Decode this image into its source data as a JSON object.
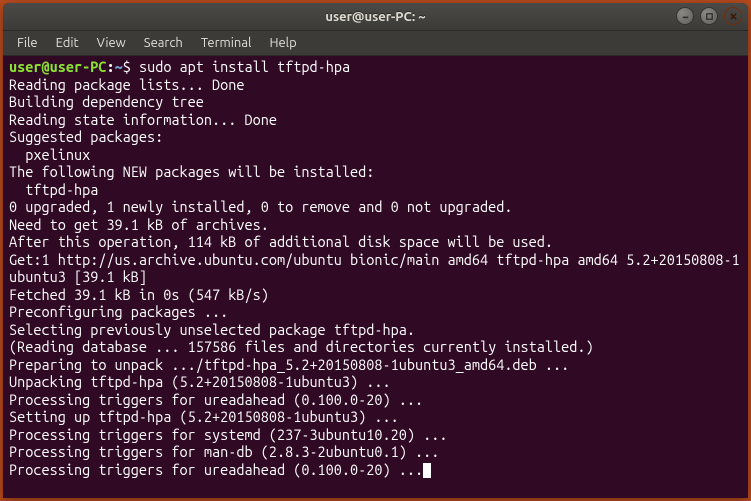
{
  "title": "user@user-PC: ~",
  "menus": [
    "File",
    "Edit",
    "View",
    "Search",
    "Terminal",
    "Help"
  ],
  "prompt": {
    "userhost": "user@user-PC",
    "path": "~",
    "symbol": "$"
  },
  "command": "sudo apt install tftpd-hpa",
  "output": "Reading package lists... Done\nBuilding dependency tree\nReading state information... Done\nSuggested packages:\n  pxelinux\nThe following NEW packages will be installed:\n  tftpd-hpa\n0 upgraded, 1 newly installed, 0 to remove and 0 not upgraded.\nNeed to get 39.1 kB of archives.\nAfter this operation, 114 kB of additional disk space will be used.\nGet:1 http://us.archive.ubuntu.com/ubuntu bionic/main amd64 tftpd-hpa amd64 5.2+20150808-1ubuntu3 [39.1 kB]\nFetched 39.1 kB in 0s (547 kB/s)\nPreconfiguring packages ...\nSelecting previously unselected package tftpd-hpa.\n(Reading database ... 157586 files and directories currently installed.)\nPreparing to unpack .../tftpd-hpa_5.2+20150808-1ubuntu3_amd64.deb ...\nUnpacking tftpd-hpa (5.2+20150808-1ubuntu3) ...\nProcessing triggers for ureadahead (0.100.0-20) ...\nSetting up tftpd-hpa (5.2+20150808-1ubuntu3) ...\nProcessing triggers for systemd (237-3ubuntu10.20) ...\nProcessing triggers for man-db (2.8.3-2ubuntu0.1) ...\nProcessing triggers for ureadahead (0.100.0-20) ..."
}
